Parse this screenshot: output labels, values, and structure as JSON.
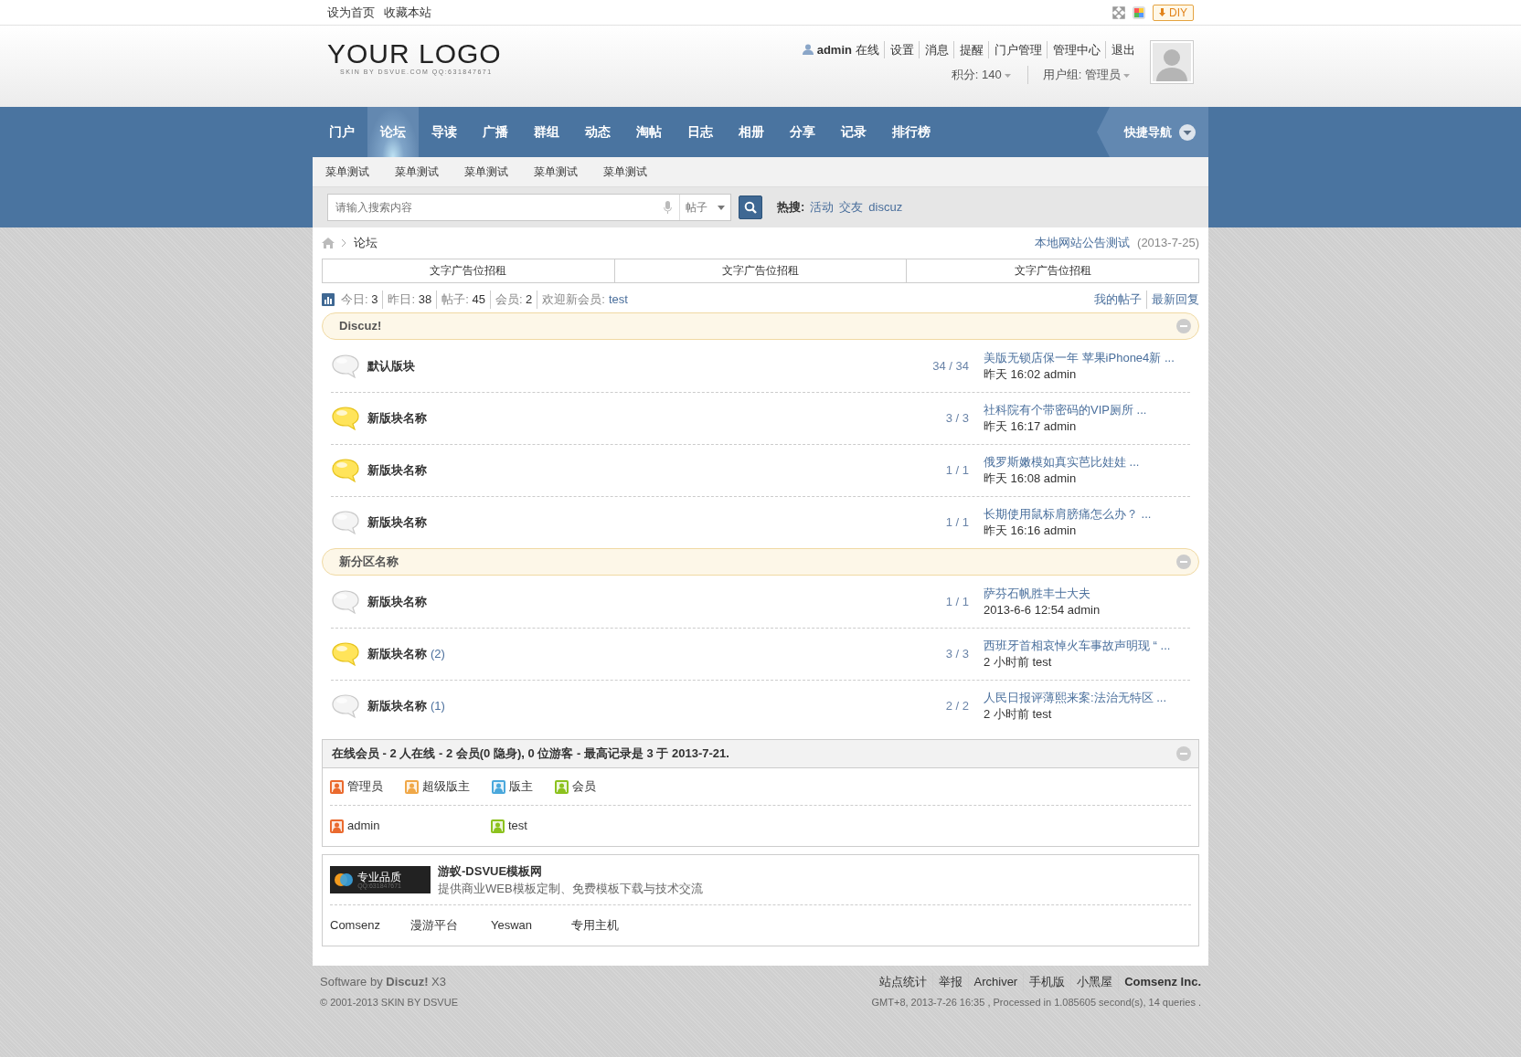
{
  "topbar": {
    "links": [
      "设为首页",
      "收藏本站"
    ],
    "diy_label": "DIY"
  },
  "header": {
    "logo": "YOUR LOGO",
    "logo_tagline": "SKIN BY DSVUE.COM QQ:631847671",
    "username": "admin",
    "online_status": "在线",
    "links": [
      "设置",
      "消息",
      "提醒",
      "门户管理",
      "管理中心",
      "退出"
    ],
    "credits": "积分: 140",
    "usergroup": "用户组: 管理员"
  },
  "nav": {
    "items": [
      {
        "label": "门户",
        "selected": false
      },
      {
        "label": "论坛",
        "selected": true
      },
      {
        "label": "导读",
        "selected": false
      },
      {
        "label": "广播",
        "selected": false
      },
      {
        "label": "群组",
        "selected": false
      },
      {
        "label": "动态",
        "selected": false
      },
      {
        "label": "淘帖",
        "selected": false
      },
      {
        "label": "日志",
        "selected": false
      },
      {
        "label": "相册",
        "selected": false
      },
      {
        "label": "分享",
        "selected": false
      },
      {
        "label": "记录",
        "selected": false
      },
      {
        "label": "排行榜",
        "selected": false
      }
    ],
    "quick_nav": "快捷导航"
  },
  "submenu": [
    "菜单测试",
    "菜单测试",
    "菜单测试",
    "菜单测试",
    "菜单测试"
  ],
  "search": {
    "placeholder": "请输入搜索内容",
    "type": "帖子",
    "hot_label": "热搜:",
    "hot": [
      "活动",
      "交友",
      "discuz"
    ]
  },
  "breadcrumb": {
    "items": [
      "论坛"
    ],
    "notice": "本地网站公告测试",
    "notice_date": "(2013-7-25)"
  },
  "ads": [
    "文字广告位招租",
    "文字广告位招租",
    "文字广告位招租"
  ],
  "stats": {
    "items": [
      {
        "label": "今日:",
        "value": "3"
      },
      {
        "label": "昨日:",
        "value": "38"
      },
      {
        "label": "帖子:",
        "value": "45"
      },
      {
        "label": "会员:",
        "value": "2"
      }
    ],
    "welcome": "欢迎新会员:",
    "new_member": "test",
    "links": [
      "我的帖子",
      "最新回复"
    ]
  },
  "sections": [
    {
      "title": "Discuz!",
      "forums": [
        {
          "name": "默认版块",
          "has_new": false,
          "counts": "34 / 34",
          "last_title": "美版无锁店保一年 苹果iPhone4新 ...",
          "last_info": "昨天 16:02 admin"
        },
        {
          "name": "新版块名称",
          "has_new": true,
          "counts": "3 / 3",
          "last_title": "社科院有个带密码的VIP厕所 ...",
          "last_info": "昨天 16:17 admin"
        },
        {
          "name": "新版块名称",
          "has_new": true,
          "counts": "1 / 1",
          "last_title": "俄罗斯嫩模如真实芭比娃娃 ...",
          "last_info": "昨天 16:08 admin"
        },
        {
          "name": "新版块名称",
          "has_new": false,
          "counts": "1 / 1",
          "last_title": "长期使用鼠标肩膀痛怎么办？ ...",
          "last_info": "昨天 16:16 admin"
        }
      ]
    },
    {
      "title": "新分区名称",
      "forums": [
        {
          "name": "新版块名称",
          "has_new": false,
          "counts": "1 / 1",
          "last_title": "萨芬石帆胜丰士大夫",
          "last_info": "2013-6-6 12:54 admin"
        },
        {
          "name": "新版块名称",
          "today": "(2)",
          "has_new": true,
          "counts": "3 / 3",
          "last_title": "西班牙首相哀悼火车事故声明现 “ ...",
          "last_info": "2 小时前 test"
        },
        {
          "name": "新版块名称",
          "today": "(1)",
          "has_new": false,
          "counts": "2 / 2",
          "last_title": "人民日报评薄熙来案:法治无特区 ...",
          "last_info": "2 小时前 test"
        }
      ]
    }
  ],
  "online": {
    "title": "在线会员 - 2 人在线 - 2 会员(0 隐身), 0 位游客 - 最高记录是 3 于 2013-7-21.",
    "legend": [
      {
        "label": "管理员",
        "color": "#ea6a2e"
      },
      {
        "label": "超级版主",
        "color": "#f0a848"
      },
      {
        "label": "版主",
        "color": "#4aa8dc"
      },
      {
        "label": "会员",
        "color": "#8cc21e"
      }
    ],
    "users": [
      {
        "name": "admin",
        "color": "#ea6a2e"
      },
      {
        "name": "test",
        "color": "#8cc21e"
      }
    ]
  },
  "partners": {
    "badge": "专业品质",
    "badge_sub": "QQ:631847671",
    "title": "游蚁-DSVUE模板网",
    "description": "提供商业WEB模板定制、免费模板下载与技术交流",
    "links": [
      "Comsenz",
      "漫游平台",
      "Yeswan",
      "专用主机"
    ]
  },
  "footer": {
    "powered": "Software by **Discuz!** X3",
    "copyright": "© 2001-2013 SKIN BY DSVUE",
    "links": [
      {
        "label": "站点统计",
        "bold": false
      },
      {
        "label": "举报",
        "bold": false
      },
      {
        "label": "Archiver",
        "bold": false
      },
      {
        "label": "手机版",
        "bold": false
      },
      {
        "label": "小黑屋",
        "bold": false
      },
      {
        "label": "Comsenz Inc.",
        "bold": true
      }
    ],
    "info": "GMT+8, 2013-7-26 16:35 , Processed in 1.085605 second(s), 14 queries ."
  }
}
